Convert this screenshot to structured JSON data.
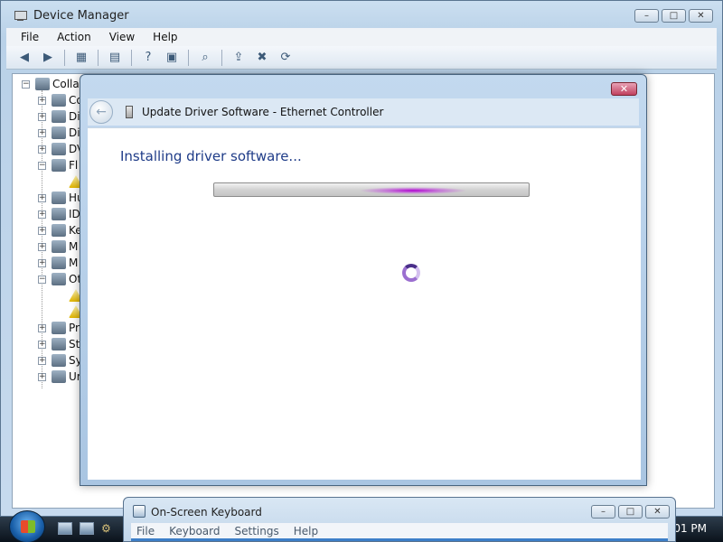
{
  "device_manager": {
    "title": "Device Manager",
    "caption": {
      "minimize": "–",
      "maximize": "□",
      "close": "✕"
    },
    "menu": [
      "File",
      "Action",
      "View",
      "Help"
    ],
    "toolbar_icons": [
      "back-arrow-icon",
      "forward-arrow-icon",
      "show-hide-console-tree-icon",
      "properties-icon",
      "help-icon",
      "action-pane-icon",
      "scan-hardware-icon",
      "update-driver-icon",
      "disable-device-icon",
      "uninstall-device-icon"
    ],
    "tree": {
      "root": "Collab",
      "items": [
        "Co",
        "Di",
        "Di",
        "DV",
        "Fl",
        "",
        "Hu",
        "ID",
        "Ke",
        "M",
        "M",
        "Ot",
        "",
        "",
        "Pr",
        "St",
        "Sy",
        "Ur"
      ]
    }
  },
  "wizard": {
    "title": "Update Driver Software - Ethernet Controller",
    "heading": "Installing driver software...",
    "close_label": "✕",
    "back_label": "←",
    "progress": "indeterminate"
  },
  "osk": {
    "title": "On-Screen Keyboard",
    "menu": [
      "File",
      "Keyboard",
      "Settings",
      "Help"
    ],
    "caption": {
      "minimize": "–",
      "maximize": "□",
      "close": "✕"
    }
  },
  "taskbar": {
    "clock": ":01 PM"
  },
  "colors": {
    "accent_heading": "#1f3c88",
    "progress_glow": "#b000d0",
    "wizard_close": "#c0405e"
  }
}
